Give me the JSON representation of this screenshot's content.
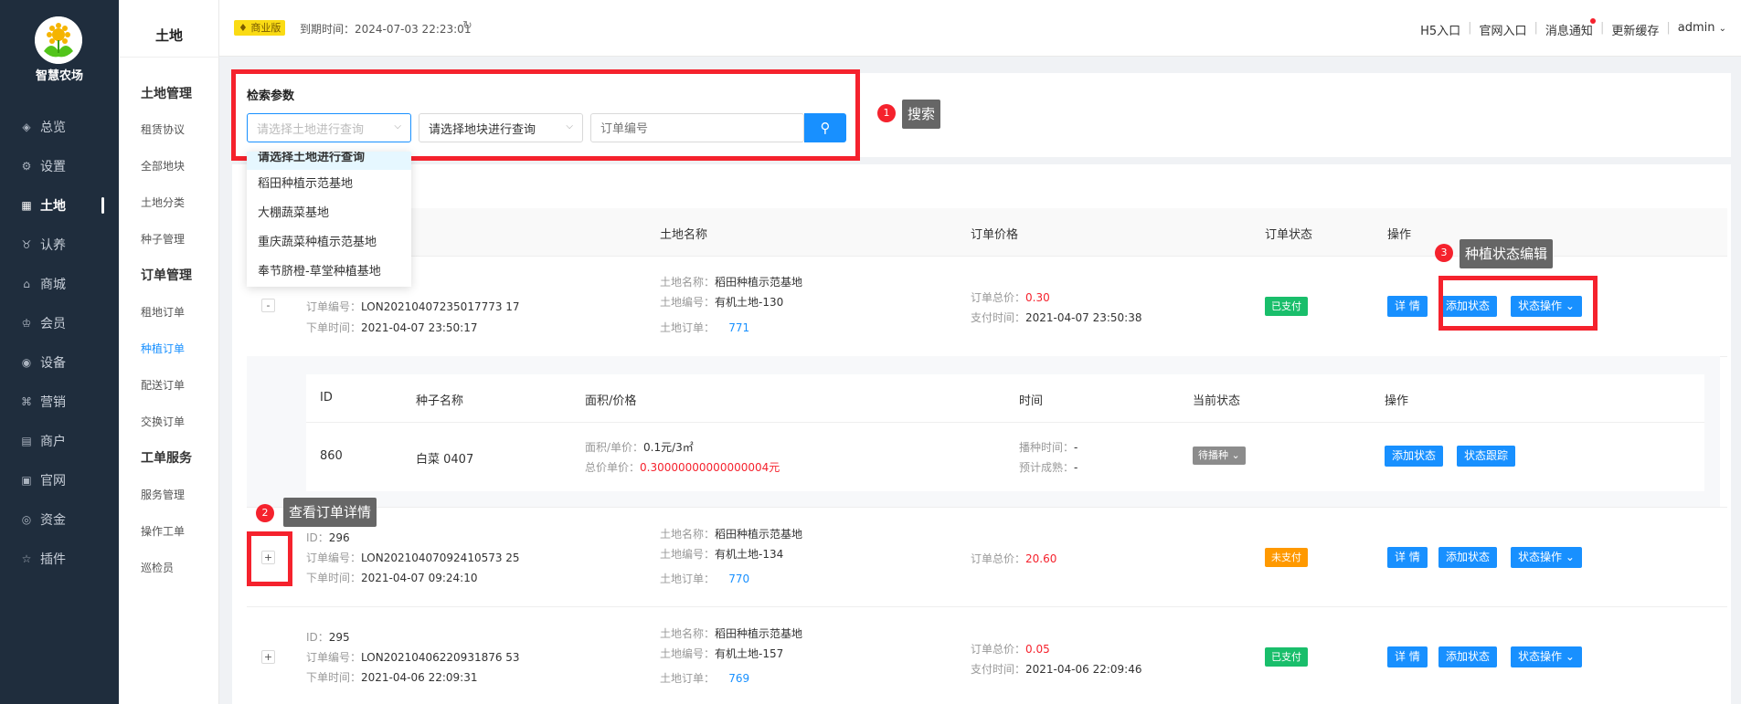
{
  "app": {
    "name": "智慧农场"
  },
  "nav": [
    {
      "label": "总览",
      "icon": "dashboard-icon"
    },
    {
      "label": "设置",
      "icon": "gear-icon"
    },
    {
      "label": "土地",
      "icon": "grid-icon"
    },
    {
      "label": "认养",
      "icon": "paw-icon"
    },
    {
      "label": "商城",
      "icon": "shop-icon"
    },
    {
      "label": "会员",
      "icon": "crown-icon"
    },
    {
      "label": "设备",
      "icon": "device-icon"
    },
    {
      "label": "营销",
      "icon": "command-icon"
    },
    {
      "label": "商户",
      "icon": "store-icon"
    },
    {
      "label": "官网",
      "icon": "window-icon"
    },
    {
      "label": "资金",
      "icon": "coin-icon"
    },
    {
      "label": "插件",
      "icon": "star-icon"
    }
  ],
  "submenu": {
    "title": "土地",
    "group1": "土地管理",
    "g1_items": [
      "租赁协议",
      "全部地块",
      "土地分类",
      "种子管理"
    ],
    "group2": "订单管理",
    "g2_items": [
      "租地订单",
      "种植订单",
      "配送订单",
      "交换订单"
    ],
    "group3": "工单服务",
    "g3_items": [
      "服务管理",
      "操作工单",
      "巡检员"
    ]
  },
  "topbar": {
    "badge": "商业版",
    "expire": "到期时间：2024-07-03 22:23:01",
    "links": [
      "H5入口",
      "官网入口",
      "消息通知",
      "更新缓存",
      "admin"
    ]
  },
  "search": {
    "title": "检索参数",
    "land_placeholder": "请选择土地进行查询",
    "plot_value": "请选择地块进行查询",
    "order_placeholder": "订单编号"
  },
  "dropdown": [
    "请选择土地进行查询",
    "稻田种植示范基地",
    "大棚蔬菜基地",
    "重庆蔬菜种植示范基地",
    "奉节脐橙-草堂种植基地"
  ],
  "table": {
    "headers": [
      "土地名称",
      "订单价格",
      "订单状态",
      "操作"
    ],
    "rows": [
      {
        "order_no_label": "订单编号：",
        "order_no": "LON20210407235017773 17",
        "time_label": "下单时间：",
        "time": "2021-04-07 23:50:17",
        "land_name_label": "土地名称：",
        "land_name": "稻田种植示范基地",
        "land_no_label": "土地编号：",
        "land_no": "有机土地-130",
        "land_order_label": "土地订单：",
        "land_order": "771",
        "total_label": "订单总价：",
        "total": "0.30",
        "pay_label": "支付时间：",
        "pay_time": "2021-04-07 23:50:38",
        "status": "已支付"
      },
      {
        "id_label": "ID：",
        "id": "296",
        "order_no_label": "订单编号：",
        "order_no": "LON20210407092410573 25",
        "time_label": "下单时间：",
        "time": "2021-04-07 09:24:10",
        "land_name_label": "土地名称：",
        "land_name": "稻田种植示范基地",
        "land_no_label": "土地编号：",
        "land_no": "有机土地-134",
        "land_order_label": "土地订单：",
        "land_order": "770",
        "total_label": "订单总价：",
        "total": "20.60",
        "status": "未支付"
      },
      {
        "id_label": "ID：",
        "id": "295",
        "order_no_label": "订单编号：",
        "order_no": "LON20210406220931876 53",
        "time_label": "下单时间：",
        "time": "2021-04-06 22:09:31",
        "land_name_label": "土地名称：",
        "land_name": "稻田种植示范基地",
        "land_no_label": "土地编号：",
        "land_no": "有机土地-157",
        "land_order_label": "土地订单：",
        "land_order": "769",
        "total_label": "订单总价：",
        "total": "0.05",
        "pay_label": "支付时间：",
        "pay_time": "2021-04-06 22:09:46",
        "status": "已支付"
      }
    ],
    "actions": {
      "detail": "详 情",
      "add_status": "添加状态",
      "status_op": "状态操作"
    }
  },
  "subtable": {
    "headers": [
      "ID",
      "种子名称",
      "面积/价格",
      "时间",
      "当前状态",
      "操作"
    ],
    "row": {
      "id": "860",
      "seed": "白菜 0407",
      "area_label": "面积/单价：",
      "area": "0.1元/3㎡",
      "price_label": "总价单价：",
      "price": "0.30000000000000004元",
      "sow_label": "播种时间：",
      "sow": "-",
      "harvest_label": "预计成熟：",
      "harvest": "-",
      "status": "待播种",
      "add_status": "添加状态",
      "track": "状态跟踪"
    }
  },
  "annotations": [
    {
      "num": "1",
      "text": "搜索"
    },
    {
      "num": "2",
      "text": "查看订单详情"
    },
    {
      "num": "3",
      "text": "种植状态编辑"
    }
  ]
}
